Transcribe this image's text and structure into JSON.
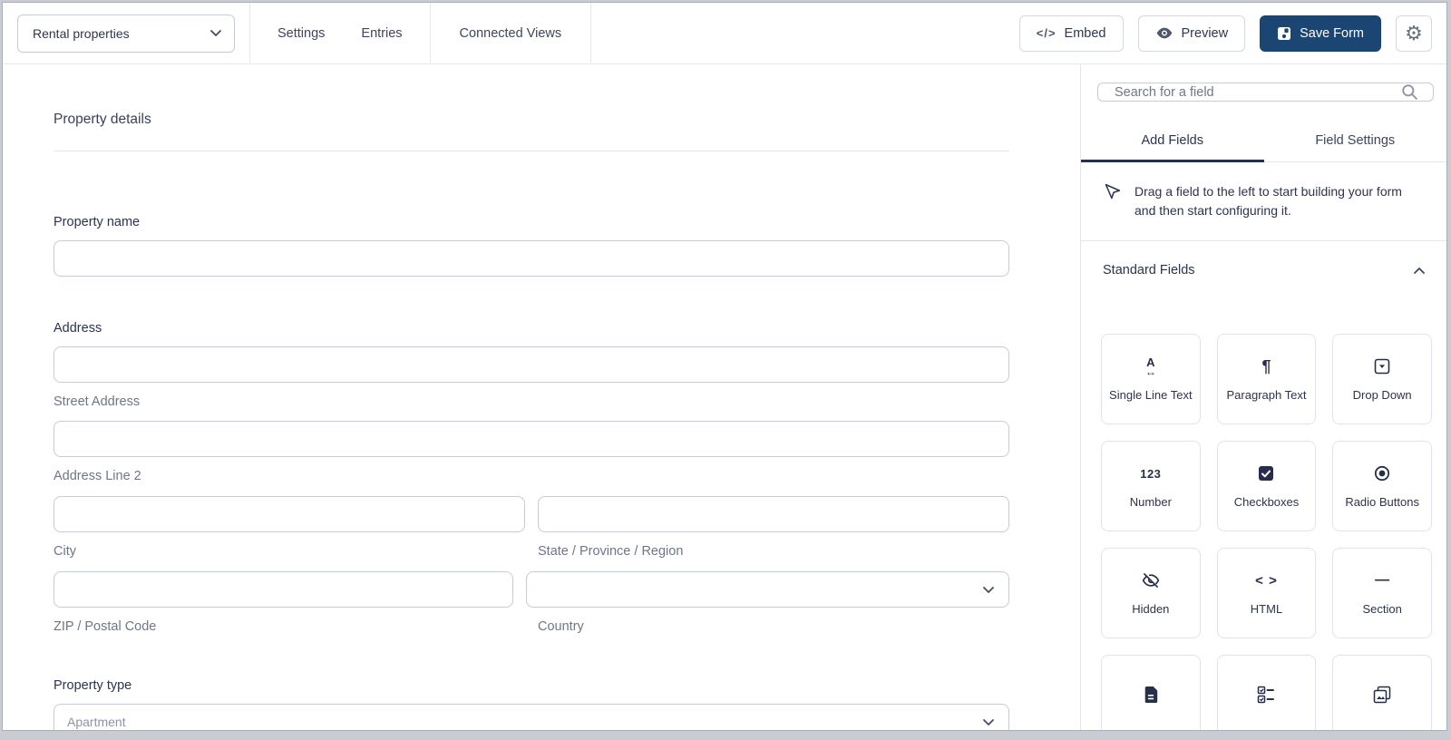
{
  "header": {
    "workspace_select": {
      "value": "Rental properties"
    },
    "nav": [
      {
        "label": "Settings"
      },
      {
        "label": "Entries"
      },
      {
        "label": "Connected Views"
      }
    ],
    "actions": {
      "embed": "Embed",
      "preview": "Preview",
      "save": "Save Form"
    }
  },
  "main": {
    "title": "Property details",
    "property_name": {
      "label": "Property name",
      "value": ""
    },
    "address": {
      "label": "Address",
      "street_label": "Street Address",
      "street_value": "",
      "line2_label": "Address Line 2",
      "line2_value": "",
      "city_label": "City",
      "city_value": "",
      "state_label": "State / Province / Region",
      "state_value": "",
      "zip_label": "ZIP / Postal Code",
      "zip_value": "",
      "country_label": "Country",
      "country_value": ""
    },
    "property_type": {
      "label": "Property type",
      "value": "Apartment"
    }
  },
  "sidebar": {
    "search": {
      "placeholder": "Search for a field"
    },
    "tabs": [
      {
        "label": "Add Fields",
        "active": true
      },
      {
        "label": "Field Settings",
        "active": false
      }
    ],
    "instruction": "Drag a field to the left to start building your form and then start configuring it.",
    "standard_fields": {
      "title": "Standard Fields",
      "items": [
        {
          "label": "Single Line Text",
          "icon": "single-line-text-icon"
        },
        {
          "label": "Paragraph Text",
          "icon": "paragraph-icon"
        },
        {
          "label": "Drop Down",
          "icon": "dropdown-icon"
        },
        {
          "label": "Number",
          "icon": "number-icon"
        },
        {
          "label": "Checkboxes",
          "icon": "checkbox-icon"
        },
        {
          "label": "Radio Buttons",
          "icon": "radio-icon"
        },
        {
          "label": "Hidden",
          "icon": "eye-off-icon"
        },
        {
          "label": "HTML",
          "icon": "code-icon"
        },
        {
          "label": "Section",
          "icon": "section-icon"
        },
        {
          "label": "",
          "icon": "document-icon"
        },
        {
          "label": "",
          "icon": "checklist-icon"
        },
        {
          "label": "",
          "icon": "images-icon"
        }
      ]
    }
  },
  "icons": {
    "letter_a": "A",
    "h_arrow": "↔",
    "pilcrow": "¶",
    "number": "123",
    "code": "< >",
    "dash": "—",
    "embed_code": "</>",
    "gear": "⚙"
  },
  "colors": {
    "primary_navy": "#1b4572",
    "tab_underline": "#24304e",
    "icon_navy": "#262e4c",
    "input_border": "#c6cbdc",
    "divider": "#e6e8ee",
    "text_dark": "#2b3350",
    "text_gray": "#6e7688"
  }
}
